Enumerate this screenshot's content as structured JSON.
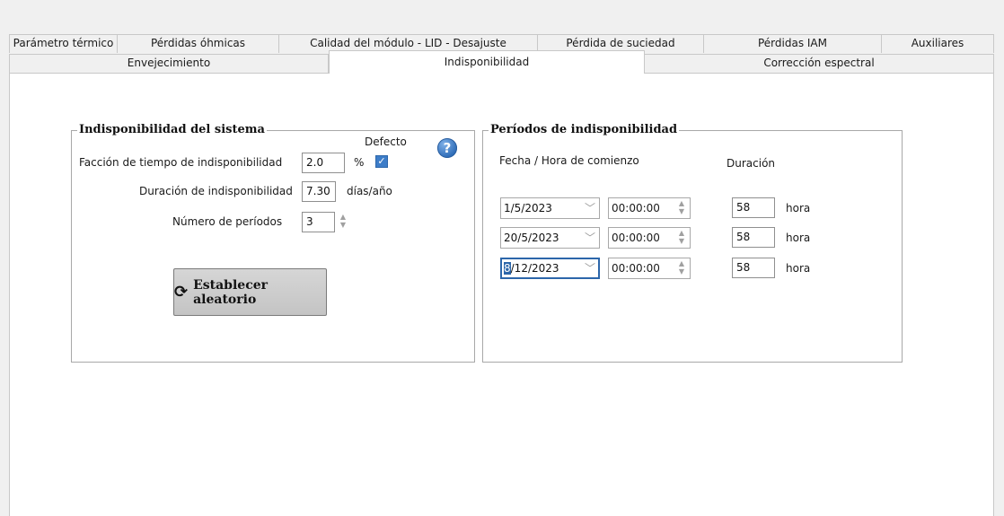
{
  "tabs_row1": [
    "Parámetro térmico",
    "Pérdidas óhmicas",
    "Calidad del módulo - LID - Desajuste",
    "Pérdida de suciedad",
    "Pérdidas IAM",
    "Auxiliares"
  ],
  "tabs_row2": [
    "Envejecimiento",
    "Indisponibilidad",
    "Corrección espectral"
  ],
  "active_tab": "Indisponibilidad",
  "system": {
    "title": "Indisponibilidad del sistema",
    "default_label": "Defecto",
    "help_icon": "help-icon",
    "fraction_label": "Facción de tiempo de indisponibilidad",
    "fraction_value": "2.0",
    "fraction_unit": "%",
    "default_checked": true,
    "duration_label": "Duración de indisponibilidad",
    "duration_value": "7.30",
    "duration_unit": "días/año",
    "periods_label": "Número de períodos",
    "periods_value": "3",
    "random_button": "Establecer aleatorio",
    "random_icon": "refresh-icon"
  },
  "periods": {
    "title": "Períodos de indisponibilidad",
    "start_header": "Fecha / Hora de comienzo",
    "duration_header": "Duración",
    "unit": "hora",
    "rows": [
      {
        "date": "1/5/2023",
        "time": "00:00:00",
        "duration": "58"
      },
      {
        "date": "20/5/2023",
        "time": "00:00:00",
        "duration": "58"
      },
      {
        "date_sel": "8",
        "date_rest": "/12/2023",
        "time": "00:00:00",
        "duration": "58"
      }
    ]
  },
  "colors": {
    "accent": "#2c66aa",
    "tab_bg": "#f0f0f0",
    "panel_bg": "#ffffff"
  }
}
